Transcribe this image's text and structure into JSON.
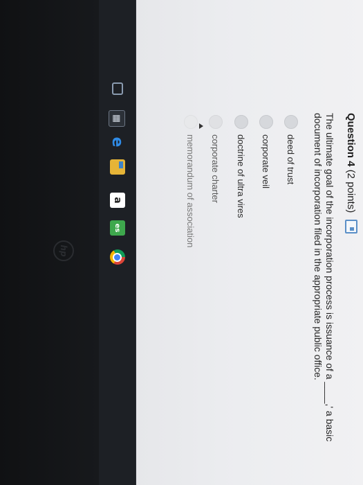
{
  "question": {
    "number_label": "Question 4",
    "points_label": "(2 points)",
    "text": "The ultimate goal of the incorporation process is issuance of a ____,' a basic document of incorporation filed in the appropriate public office."
  },
  "options": [
    {
      "label": "deed of trust"
    },
    {
      "label": "corporate veil"
    },
    {
      "label": "doctrine of ultra vires"
    },
    {
      "label": "corporate charter"
    },
    {
      "label": "memorandum of association"
    }
  ],
  "taskbar": {
    "icons": [
      "task-view-icon",
      "store-icon",
      "edge-icon",
      "file-explorer-icon",
      "amazon-icon",
      "whatsapp-icon",
      "chrome-icon"
    ],
    "amazon_glyph": "a",
    "whatsapp_glyph": "es"
  },
  "bezel": {
    "logo_text": "hp"
  },
  "colors": {
    "screen_bg": "#ecedf0",
    "accent": "#5a8fc7",
    "taskbar_bg": "#1d2025"
  }
}
